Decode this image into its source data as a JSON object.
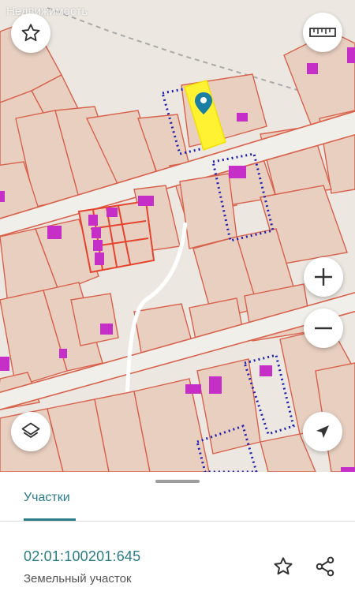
{
  "map": {
    "watermark": "Недвижимость",
    "colors": {
      "background": "#ece8e1",
      "parcel_fill": "#e8cfc0",
      "parcel_border": "#d8614c",
      "road": "#f1efea",
      "building": "#c52fc8",
      "selected_parcel": "#fff233",
      "dotted_outline": "#1f1fb0",
      "marker": "#1a7fa3"
    },
    "controls": {
      "favorite_icon": "star-outline-icon",
      "ruler_icon": "ruler-icon",
      "zoom_in_icon": "plus-icon",
      "zoom_out_icon": "minus-icon",
      "layers_icon": "layers-icon",
      "locate_icon": "navigation-arrow-icon"
    }
  },
  "panel": {
    "tab_label": "Участки",
    "cadastral_number": "02:01:100201:645",
    "parcel_type": "Земельный участок",
    "favorite_icon": "star-outline-icon",
    "share_icon": "share-icon",
    "accent_color": "#2a7d86"
  }
}
